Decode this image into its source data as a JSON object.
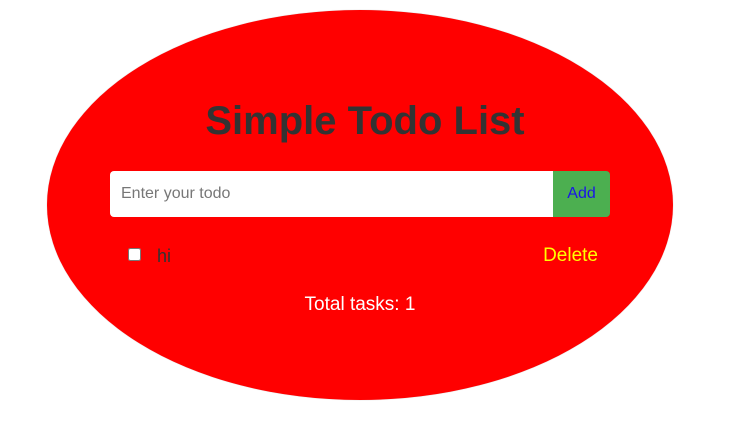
{
  "app": {
    "title": "Simple Todo List"
  },
  "form": {
    "input_value": "",
    "input_placeholder": "Enter your todo",
    "add_label": "Add"
  },
  "todos": [
    {
      "text": "hi",
      "completed": false,
      "delete_label": "Delete"
    }
  ],
  "summary": {
    "total_text": "Total tasks: 1"
  },
  "colors": {
    "oval": "#ff0000",
    "title": "#333333",
    "add_button_bg": "#4caf50",
    "add_button_text": "#1a16e6",
    "delete_text": "#ffff00",
    "total_text": "#ffffff"
  }
}
